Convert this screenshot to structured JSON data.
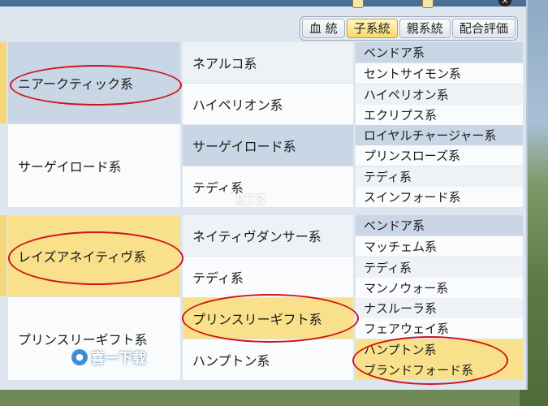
{
  "window": {
    "close_label": "×"
  },
  "tabs": [
    {
      "label": "血 統",
      "active": false
    },
    {
      "label": "子系統",
      "active": true
    },
    {
      "label": "親系統",
      "active": false
    },
    {
      "label": "配合評価",
      "active": false
    }
  ],
  "groups": [
    {
      "sire_line": "ニアークティック系",
      "sub_lines": [
        {
          "name": "ネアルコ系",
          "children": [
            "ベンドア系",
            "セントサイモン系"
          ]
        },
        {
          "name": "ハイペリオン系",
          "children": [
            "ハイペリオン系",
            "エクリプス系"
          ]
        }
      ],
      "dam_line": "サーゲイロード系",
      "dam_sub_lines": [
        {
          "name": "サーゲイロード系",
          "children": [
            "ロイヤルチャージャー系",
            "プリンスローズ系"
          ]
        },
        {
          "name": "テディ系",
          "children": [
            "テディ系",
            "スインフォード系"
          ]
        }
      ]
    },
    {
      "sire_line": "レイズアネイティヴ系",
      "sub_lines": [
        {
          "name": "ネイティヴダンサー系",
          "children": [
            "ベンドア系",
            "マッチェム系"
          ]
        },
        {
          "name": "テディ系",
          "children": [
            "テディ系",
            "マンノウォー系"
          ]
        }
      ],
      "dam_line": "プリンスリーギフト系",
      "dam_sub_lines": [
        {
          "name": "プリンスリーギフト系",
          "children": [
            "ナスルーラ系",
            "フェアウェイ系"
          ]
        },
        {
          "name": "ハンプトン系",
          "children": [
            "ハンプトン系",
            "ブランドフォード系"
          ]
        }
      ]
    }
  ],
  "watermark": {
    "site": "k73",
    "badge": "喜一下载"
  },
  "colors": {
    "highlight": "#f9e08a",
    "annotation_circle": "#d1131b",
    "active_tab": "#f7d86a"
  }
}
